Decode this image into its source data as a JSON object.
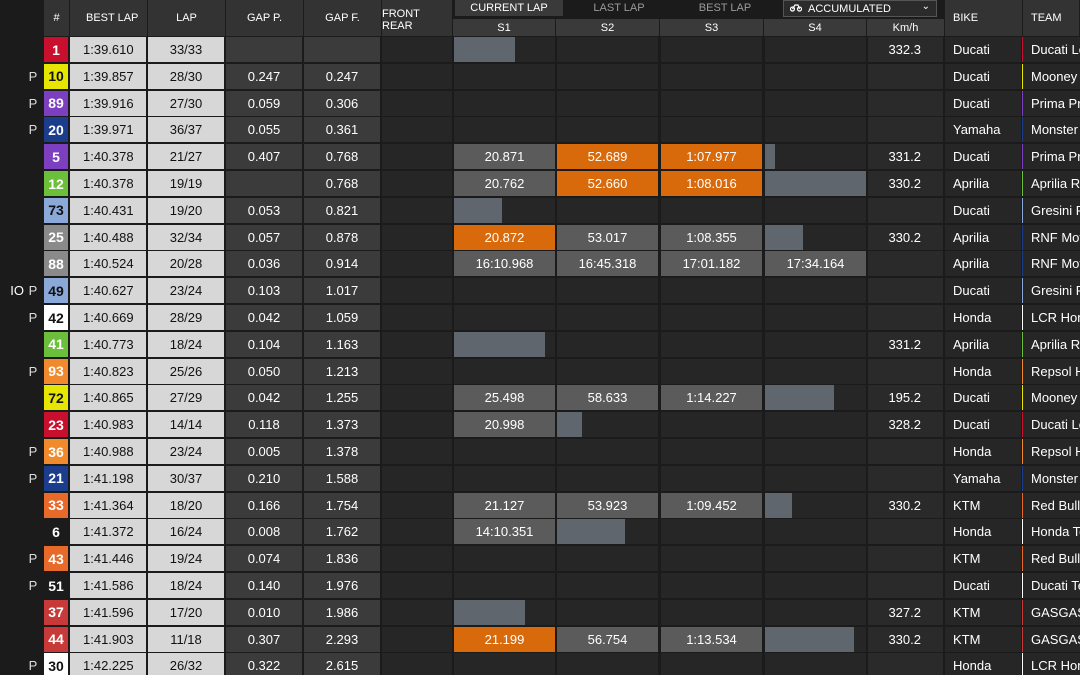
{
  "headers": {
    "num": "#",
    "best_lap": "BEST LAP",
    "lap": "LAP",
    "gap_p": "GAP P.",
    "gap_f": "GAP F.",
    "front_rear": "FRONT REAR",
    "bike": "BIKE",
    "team": "TEAM",
    "kmh": "Km/h"
  },
  "tabs": {
    "current_lap": "CURRENT LAP",
    "last_lap": "LAST LAP",
    "best_lap": "BEST LAP",
    "accumulated": "ACCUMULATED",
    "active": "current_lap"
  },
  "sectors": [
    "S1",
    "S2",
    "S3",
    "S4"
  ],
  "colors": {
    "orange": "#d86a0c",
    "sector_gray": "#5b5b5b",
    "progress_bar": "#5f666d"
  },
  "riders": [
    {
      "name": "",
      "pit": "",
      "num": "1",
      "num_bg": "#c8102e",
      "num_fg": "#ffffff",
      "best": "1:39.610",
      "lap": "33/33",
      "gap_p": "",
      "gap_f": "",
      "s1": "",
      "s1_bg": "",
      "s2": "",
      "s2_bg": "",
      "s3": "",
      "s3_bg": "",
      "prog_sector": 1,
      "prog": 0.6,
      "kmh": "332.3",
      "bike": "Ducati",
      "team": "Ducati Le",
      "team_color": "#c8102e"
    },
    {
      "name": "",
      "pit": "P",
      "num": "10",
      "num_bg": "#e6e600",
      "num_fg": "#111111",
      "best": "1:39.857",
      "lap": "28/30",
      "gap_p": "0.247",
      "gap_f": "0.247",
      "s1": "",
      "s1_bg": "",
      "s2": "",
      "s2_bg": "",
      "s3": "",
      "s3_bg": "",
      "prog_sector": 0,
      "prog": 0,
      "kmh": "",
      "bike": "Ducati",
      "team": "Mooney V",
      "team_color": "#e6e600"
    },
    {
      "name": "",
      "pit": "P",
      "num": "89",
      "num_bg": "#7b3fbf",
      "num_fg": "#ffffff",
      "best": "1:39.916",
      "lap": "27/30",
      "gap_p": "0.059",
      "gap_f": "0.306",
      "s1": "",
      "s1_bg": "",
      "s2": "",
      "s2_bg": "",
      "s3": "",
      "s3_bg": "",
      "prog_sector": 0,
      "prog": 0,
      "kmh": "",
      "bike": "Ducati",
      "team": "Prima Pra",
      "team_color": "#7b3fbf"
    },
    {
      "name": "",
      "pit": "P",
      "num": "20",
      "num_bg": "#1c3c8c",
      "num_fg": "#ffffff",
      "best": "1:39.971",
      "lap": "36/37",
      "gap_p": "0.055",
      "gap_f": "0.361",
      "s1": "",
      "s1_bg": "",
      "s2": "",
      "s2_bg": "",
      "s3": "",
      "s3_bg": "",
      "prog_sector": 0,
      "prog": 0,
      "kmh": "",
      "bike": "Yamaha",
      "team": "Monster",
      "team_color": "#1c3c8c"
    },
    {
      "name": "",
      "pit": "",
      "num": "5",
      "num_bg": "#7b3fbf",
      "num_fg": "#ffffff",
      "best": "1:40.378",
      "lap": "21/27",
      "gap_p": "0.407",
      "gap_f": "0.768",
      "s1": "20.871",
      "s1_bg": "#5b5b5b",
      "s2": "52.689",
      "s2_bg": "#d86a0c",
      "s3": "1:07.977",
      "s3_bg": "#d86a0c",
      "prog_sector": 4,
      "prog": 0.1,
      "kmh": "331.2",
      "bike": "Ducati",
      "team": "Prima Pra",
      "team_color": "#7b3fbf"
    },
    {
      "name": "",
      "pit": "",
      "num": "12",
      "num_bg": "#6bbf3a",
      "num_fg": "#ffffff",
      "best": "1:40.378",
      "lap": "19/19",
      "gap_p": "",
      "gap_f": "0.768",
      "s1": "20.762",
      "s1_bg": "#5b5b5b",
      "s2": "52.660",
      "s2_bg": "#d86a0c",
      "s3": "1:08.016",
      "s3_bg": "#d86a0c",
      "prog_sector": 4,
      "prog": 1.0,
      "kmh": "330.2",
      "bike": "Aprilia",
      "team": "Aprilia Ra",
      "team_color": "#6bbf3a"
    },
    {
      "name": "",
      "pit": "",
      "num": "73",
      "num_bg": "#8aa8d8",
      "num_fg": "#111111",
      "best": "1:40.431",
      "lap": "19/20",
      "gap_p": "0.053",
      "gap_f": "0.821",
      "s1": "",
      "s1_bg": "",
      "s2": "",
      "s2_bg": "",
      "s3": "",
      "s3_bg": "",
      "prog_sector": 1,
      "prog": 0.48,
      "kmh": "",
      "bike": "Ducati",
      "team": "Gresini R",
      "team_color": "#8aa8d8"
    },
    {
      "name": "",
      "pit": "",
      "num": "25",
      "num_bg": "#8a8a8a",
      "num_fg": "#ffffff",
      "best": "1:40.488",
      "lap": "32/34",
      "gap_p": "0.057",
      "gap_f": "0.878",
      "s1": "20.872",
      "s1_bg": "#d86a0c",
      "s2": "53.017",
      "s2_bg": "#5b5b5b",
      "s3": "1:08.355",
      "s3_bg": "#5b5b5b",
      "prog_sector": 4,
      "prog": 0.38,
      "kmh": "330.2",
      "bike": "Aprilia",
      "team": "RNF Mot",
      "team_color": "#1c3c8c"
    },
    {
      "name": "",
      "pit": "",
      "num": "88",
      "num_bg": "#8a8a8a",
      "num_fg": "#ffffff",
      "best": "1:40.524",
      "lap": "20/28",
      "gap_p": "0.036",
      "gap_f": "0.914",
      "s1": "16:10.968",
      "s1_bg": "#5b5b5b",
      "s2": "16:45.318",
      "s2_bg": "#5b5b5b",
      "s3": "17:01.182",
      "s3_bg": "#5b5b5b",
      "s4": "17:34.164",
      "s4_bg": "#5b5b5b",
      "prog_sector": 0,
      "prog": 0,
      "kmh": "",
      "bike": "Aprilia",
      "team": "RNF Mot",
      "team_color": "#1c3c8c"
    },
    {
      "name": "IO",
      "pit": "P",
      "num": "49",
      "num_bg": "#8aa8d8",
      "num_fg": "#111111",
      "best": "1:40.627",
      "lap": "23/24",
      "gap_p": "0.103",
      "gap_f": "1.017",
      "s1": "",
      "s1_bg": "",
      "s2": "",
      "s2_bg": "",
      "s3": "",
      "s3_bg": "",
      "prog_sector": 0,
      "prog": 0,
      "kmh": "",
      "bike": "Ducati",
      "team": "Gresini R",
      "team_color": "#8aa8d8"
    },
    {
      "name": "",
      "pit": "P",
      "num": "42",
      "num_bg": "#ffffff",
      "num_fg": "#111111",
      "best": "1:40.669",
      "lap": "28/29",
      "gap_p": "0.042",
      "gap_f": "1.059",
      "s1": "",
      "s1_bg": "",
      "s2": "",
      "s2_bg": "",
      "s3": "",
      "s3_bg": "",
      "prog_sector": 0,
      "prog": 0,
      "kmh": "",
      "bike": "Honda",
      "team": "LCR Hon",
      "team_color": "#ffffff"
    },
    {
      "name": "",
      "pit": "",
      "num": "41",
      "num_bg": "#6bbf3a",
      "num_fg": "#ffffff",
      "best": "1:40.773",
      "lap": "18/24",
      "gap_p": "0.104",
      "gap_f": "1.163",
      "s1": "",
      "s1_bg": "",
      "s2": "",
      "s2_bg": "",
      "s3": "",
      "s3_bg": "",
      "prog_sector": 1,
      "prog": 0.9,
      "kmh": "331.2",
      "bike": "Aprilia",
      "team": "Aprilia Ra",
      "team_color": "#6bbf3a"
    },
    {
      "name": "",
      "pit": "P",
      "num": "93",
      "num_bg": "#f08a2c",
      "num_fg": "#ffffff",
      "best": "1:40.823",
      "lap": "25/26",
      "gap_p": "0.050",
      "gap_f": "1.213",
      "s1": "",
      "s1_bg": "",
      "s2": "",
      "s2_bg": "",
      "s3": "",
      "s3_bg": "",
      "prog_sector": 0,
      "prog": 0,
      "kmh": "",
      "bike": "Honda",
      "team": "Repsol H",
      "team_color": "#f08a2c"
    },
    {
      "name": "",
      "pit": "",
      "num": "72",
      "num_bg": "#e6e600",
      "num_fg": "#111111",
      "best": "1:40.865",
      "lap": "27/29",
      "gap_p": "0.042",
      "gap_f": "1.255",
      "s1": "25.498",
      "s1_bg": "#5b5b5b",
      "s2": "58.633",
      "s2_bg": "#5b5b5b",
      "s3": "1:14.227",
      "s3_bg": "#5b5b5b",
      "prog_sector": 4,
      "prog": 0.68,
      "kmh": "195.2",
      "bike": "Ducati",
      "team": "Mooney V",
      "team_color": "#e6e600"
    },
    {
      "name": "",
      "pit": "",
      "num": "23",
      "num_bg": "#c8102e",
      "num_fg": "#ffffff",
      "best": "1:40.983",
      "lap": "14/14",
      "gap_p": "0.118",
      "gap_f": "1.373",
      "s1": "20.998",
      "s1_bg": "#5b5b5b",
      "s2": "",
      "s2_bg": "",
      "s3": "",
      "s3_bg": "",
      "prog_sector": 2,
      "prog": 0.25,
      "kmh": "328.2",
      "bike": "Ducati",
      "team": "Ducati Le",
      "team_color": "#c8102e"
    },
    {
      "name": "",
      "pit": "P",
      "num": "36",
      "num_bg": "#f08a2c",
      "num_fg": "#ffffff",
      "best": "1:40.988",
      "lap": "23/24",
      "gap_p": "0.005",
      "gap_f": "1.378",
      "s1": "",
      "s1_bg": "",
      "s2": "",
      "s2_bg": "",
      "s3": "",
      "s3_bg": "",
      "prog_sector": 0,
      "prog": 0,
      "kmh": "",
      "bike": "Honda",
      "team": "Repsol H",
      "team_color": "#f08a2c"
    },
    {
      "name": "",
      "pit": "P",
      "num": "21",
      "num_bg": "#1c3c8c",
      "num_fg": "#ffffff",
      "best": "1:41.198",
      "lap": "30/37",
      "gap_p": "0.210",
      "gap_f": "1.588",
      "s1": "",
      "s1_bg": "",
      "s2": "",
      "s2_bg": "",
      "s3": "",
      "s3_bg": "",
      "prog_sector": 0,
      "prog": 0,
      "kmh": "",
      "bike": "Yamaha",
      "team": "Monster",
      "team_color": "#1c3c8c"
    },
    {
      "name": "",
      "pit": "",
      "num": "33",
      "num_bg": "#e86a2a",
      "num_fg": "#ffffff",
      "best": "1:41.364",
      "lap": "18/20",
      "gap_p": "0.166",
      "gap_f": "1.754",
      "s1": "21.127",
      "s1_bg": "#5b5b5b",
      "s2": "53.923",
      "s2_bg": "#5b5b5b",
      "s3": "1:09.452",
      "s3_bg": "#5b5b5b",
      "prog_sector": 4,
      "prog": 0.27,
      "kmh": "330.2",
      "bike": "KTM",
      "team": "Red Bull",
      "team_color": "#e86a2a"
    },
    {
      "name": "",
      "pit": "",
      "num": "6",
      "num_bg": "#1b1b1b",
      "num_fg": "#ffffff",
      "best": "1:41.372",
      "lap": "16/24",
      "gap_p": "0.008",
      "gap_f": "1.762",
      "s1": "14:10.351",
      "s1_bg": "#5b5b5b",
      "s2": "",
      "s2_bg": "",
      "s3": "",
      "s3_bg": "",
      "prog_sector": 2,
      "prog": 0.67,
      "kmh": "",
      "bike": "Honda",
      "team": "Honda Te",
      "team_color": "#ffffff"
    },
    {
      "name": "",
      "pit": "P",
      "num": "43",
      "num_bg": "#e86a2a",
      "num_fg": "#ffffff",
      "best": "1:41.446",
      "lap": "19/24",
      "gap_p": "0.074",
      "gap_f": "1.836",
      "s1": "",
      "s1_bg": "",
      "s2": "",
      "s2_bg": "",
      "s3": "",
      "s3_bg": "",
      "prog_sector": 0,
      "prog": 0,
      "kmh": "",
      "bike": "KTM",
      "team": "Red Bull",
      "team_color": "#e86a2a"
    },
    {
      "name": "",
      "pit": "P",
      "num": "51",
      "num_bg": "#1b1b1b",
      "num_fg": "#ffffff",
      "best": "1:41.586",
      "lap": "18/24",
      "gap_p": "0.140",
      "gap_f": "1.976",
      "s1": "",
      "s1_bg": "",
      "s2": "",
      "s2_bg": "",
      "s3": "",
      "s3_bg": "",
      "prog_sector": 0,
      "prog": 0,
      "kmh": "",
      "bike": "Ducati",
      "team": "Ducati Te",
      "team_color": "#ffffff"
    },
    {
      "name": "",
      "pit": "",
      "num": "37",
      "num_bg": "#c83a3a",
      "num_fg": "#ffffff",
      "best": "1:41.596",
      "lap": "17/20",
      "gap_p": "0.010",
      "gap_f": "1.986",
      "s1": "",
      "s1_bg": "",
      "s2": "",
      "s2_bg": "",
      "s3": "",
      "s3_bg": "",
      "prog_sector": 1,
      "prog": 0.7,
      "kmh": "327.2",
      "bike": "KTM",
      "team": "GASGAS",
      "team_color": "#c83a3a"
    },
    {
      "name": "",
      "pit": "",
      "num": "44",
      "num_bg": "#c83a3a",
      "num_fg": "#ffffff",
      "best": "1:41.903",
      "lap": "11/18",
      "gap_p": "0.307",
      "gap_f": "2.293",
      "s1": "21.199",
      "s1_bg": "#d86a0c",
      "s2": "56.754",
      "s2_bg": "#5b5b5b",
      "s3": "1:13.534",
      "s3_bg": "#5b5b5b",
      "prog_sector": 4,
      "prog": 0.88,
      "kmh": "330.2",
      "bike": "KTM",
      "team": "GASGAS",
      "team_color": "#c83a3a"
    },
    {
      "name": "",
      "pit": "P",
      "num": "30",
      "num_bg": "#ffffff",
      "num_fg": "#111111",
      "best": "1:42.225",
      "lap": "26/32",
      "gap_p": "0.322",
      "gap_f": "2.615",
      "s1": "",
      "s1_bg": "",
      "s2": "",
      "s2_bg": "",
      "s3": "",
      "s3_bg": "",
      "prog_sector": 0,
      "prog": 0,
      "kmh": "",
      "bike": "Honda",
      "team": "LCR Hon",
      "team_color": "#ffffff"
    }
  ]
}
